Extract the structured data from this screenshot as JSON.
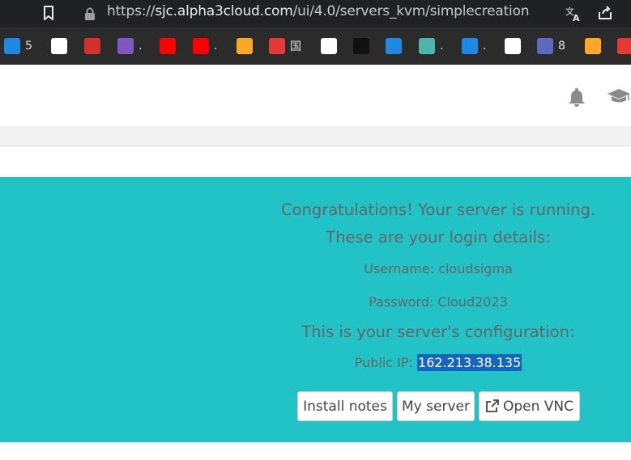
{
  "browser": {
    "url_prefix": "https://",
    "url_host": "sjc.alpha3cloud.com",
    "url_path": "/ui/4.0/servers_kvm/simplecreation"
  },
  "bookmarks": [
    {
      "icon": "cloud-icon",
      "label": "5",
      "color": "#1e88e5"
    },
    {
      "icon": "github-icon",
      "label": "",
      "color": "#ffffff"
    },
    {
      "icon": "red-logo-icon",
      "label": "",
      "color": "#d32f2f"
    },
    {
      "icon": "magnifier-icon",
      "label": ".",
      "color": "#7e57c2"
    },
    {
      "icon": "youtube-icon",
      "label": "",
      "color": "#ff0000"
    },
    {
      "icon": "youtube-icon",
      "label": ".",
      "color": "#ff0000"
    },
    {
      "icon": "star-logo-icon",
      "label": "",
      "color": "#f9a825"
    },
    {
      "icon": "chinese-logo-icon",
      "label": "国",
      "color": "#e53935"
    },
    {
      "icon": "google-icon",
      "label": "",
      "color": "#ffffff"
    },
    {
      "icon": "h-logo-icon",
      "label": "",
      "color": "#111111"
    },
    {
      "icon": "tp-logo-icon",
      "label": "",
      "color": "#1e88e5"
    },
    {
      "icon": "mountain-icon",
      "label": ".",
      "color": "#4db6ac"
    },
    {
      "icon": "cloud-box-icon",
      "label": ".",
      "color": "#1e88e5"
    },
    {
      "icon": "flower-icon",
      "label": "",
      "color": "#ffffff"
    },
    {
      "icon": "c-logo-icon",
      "label": "8",
      "color": "#5c6bc0"
    },
    {
      "icon": "ball-icon",
      "label": "",
      "color": "#ffa726"
    },
    {
      "icon": "chart-logo-icon",
      "label": "",
      "color": "#e53935"
    }
  ],
  "panel": {
    "congrats": "Congratulations! Your server is running.",
    "login_heading": "These are your login details:",
    "username_label": "Username:",
    "username_value": "cloudsigma",
    "password_label": "Password:",
    "password_value": "Cloud2023",
    "config_heading": "This is your server's configuration:",
    "ip_label": "Public IP:",
    "ip_value": "162.213.38.135"
  },
  "buttons": {
    "install_notes": "Install notes",
    "my_server": "My server",
    "open_vnc": "Open VNC"
  },
  "colors": {
    "panel_bg": "#22c3c6",
    "text": "#666666",
    "ip_highlight": "#1565c0"
  }
}
